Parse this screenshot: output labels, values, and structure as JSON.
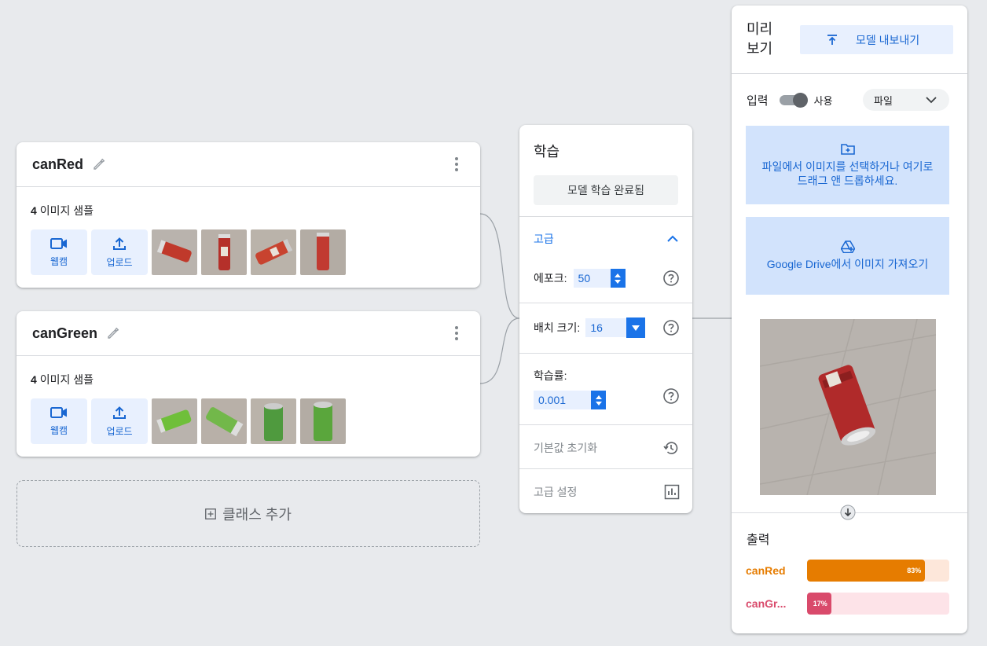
{
  "classes": [
    {
      "name": "canRed",
      "count": "4",
      "samples_label": "이미지 샘플",
      "webcam_label": "웹캠",
      "upload_label": "업로드",
      "thumb_colors": [
        "#c0392b",
        "#b5302a",
        "#c8432f",
        "#c13a31"
      ]
    },
    {
      "name": "canGreen",
      "count": "4",
      "samples_label": "이미지 샘플",
      "webcam_label": "웹캠",
      "upload_label": "업로드",
      "thumb_colors": [
        "#6fbf3a",
        "#72b84a",
        "#4f9a3e",
        "#5aa63c"
      ]
    }
  ],
  "add_class": {
    "label": "클래스 추가"
  },
  "training": {
    "title": "학습",
    "train_button": "모델 학습 완료됨",
    "advanced_label": "고급",
    "epochs_label": "에포크:",
    "epochs_value": "50",
    "batch_label": "배치 크기:",
    "batch_value": "16",
    "lr_label": "학습률:",
    "lr_value": "0.001",
    "reset_label": "기본값 초기화",
    "advanced_settings_label": "고급 설정"
  },
  "preview": {
    "title_line1": "미리",
    "title_line2": "보기",
    "export_button": "모델 내보내기",
    "input_label": "입력",
    "toggle_label": "사용",
    "source_select": "파일",
    "file_drop_text": "파일에서 이미지를 선택하거나 여기로 드래그 앤 드롭하세요.",
    "drive_text": "Google Drive에서 이미지 가져오기",
    "output_label": "출력",
    "results": [
      {
        "label": "canRed",
        "percent_text": "83%",
        "value": 0.83,
        "color": "#e67c00",
        "track": "#fde7da"
      },
      {
        "label": "canGr...",
        "percent_text": "17%",
        "value": 0.17,
        "color": "#d94a6b",
        "track": "#fde3e8"
      }
    ]
  }
}
